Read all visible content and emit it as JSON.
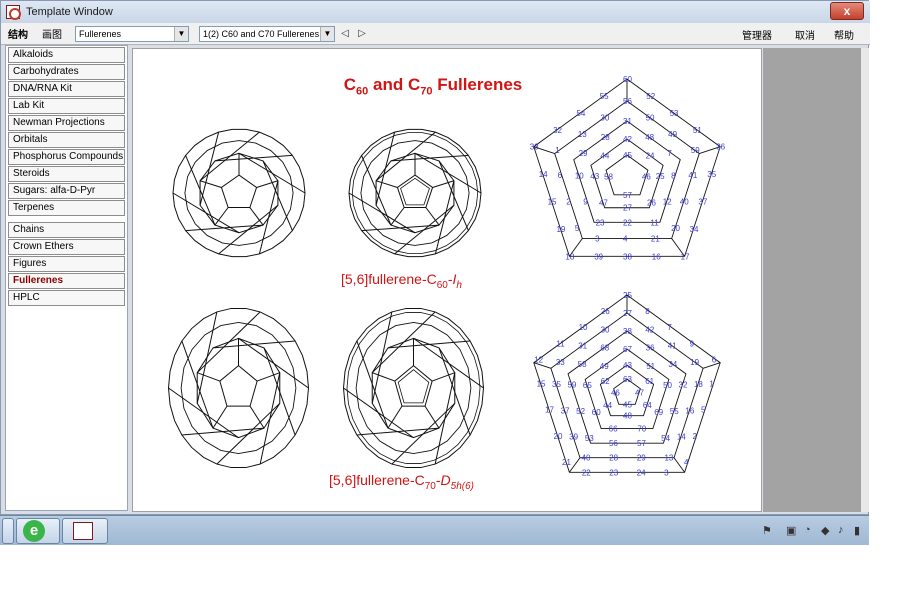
{
  "window": {
    "title": "Template Window",
    "close_glyph": "x"
  },
  "toolbar": {
    "tab_structure": "结构",
    "tab_draw": "画图",
    "category_select": "Fullerenes",
    "template_select": "1(2) C60 and C70 Fullerenes",
    "nav_back_icon": "back-arrow-icon",
    "nav_forward_icon": "forward-arrow-icon",
    "manager": "管理器",
    "cancel": "取消",
    "help": "帮助"
  },
  "sidebar": {
    "group1": [
      "Alkaloids",
      "Carbohydrates",
      "DNA/RNA Kit",
      "Lab Kit",
      "Newman Projections",
      "Orbitals",
      "Phosphorus Compounds",
      "Steroids",
      "Sugars: alfa-D-Pyr",
      "Terpenes"
    ],
    "group2": [
      "Chains",
      "Crown Ethers",
      "Figures",
      "Fullerenes",
      "HPLC"
    ],
    "selected": "Fullerenes"
  },
  "canvas": {
    "title_c": "C",
    "title_sub1": "60",
    "title_and": " and C",
    "title_sub2": "70",
    "title_end": " Fullerenes",
    "label1_a": "[5,6]fullerene-C",
    "label1_sub": "60",
    "label1_b": "-",
    "label1_i": "I",
    "label1_isub": "h",
    "label2_a": "[5,6]fullerene-C",
    "label2_sub": "70",
    "label2_b": "-",
    "label2_i": "D",
    "label2_isub": "5h(6)"
  },
  "schlegel_c60": {
    "numbers": [
      "60",
      "52",
      "53",
      "51",
      "36",
      "35",
      "37",
      "34",
      "17",
      "16",
      "38",
      "39",
      "18",
      "19",
      "15",
      "14",
      "33",
      "32",
      "54",
      "55",
      "56",
      "50",
      "49",
      "59",
      "41",
      "40",
      "20",
      "21",
      "4",
      "3",
      "5",
      "2",
      "6",
      "1",
      "13",
      "30",
      "31",
      "48",
      "7",
      "8",
      "12",
      "11",
      "22",
      "23",
      "9",
      "10",
      "29",
      "28",
      "42",
      "24",
      "25",
      "26",
      "27",
      "47",
      "43",
      "44",
      "45",
      "46",
      "57",
      "58"
    ]
  },
  "schlegel_c70": {
    "numbers": [
      "25",
      "8",
      "7",
      "9",
      "6",
      "1",
      "5",
      "2",
      "4",
      "3",
      "24",
      "23",
      "22",
      "21",
      "20",
      "17",
      "15",
      "12",
      "11",
      "10",
      "26",
      "27",
      "42",
      "41",
      "19",
      "18",
      "16",
      "14",
      "13",
      "29",
      "28",
      "40",
      "39",
      "37",
      "35",
      "33",
      "31",
      "30",
      "38",
      "36",
      "34",
      "32",
      "55",
      "54",
      "57",
      "56",
      "53",
      "52",
      "59",
      "58",
      "68",
      "67",
      "51",
      "50",
      "69",
      "70",
      "66",
      "60",
      "65",
      "49",
      "43",
      "61",
      "64",
      "48",
      "44",
      "62",
      "63",
      "47",
      "45",
      "46"
    ]
  },
  "taskbar": {
    "ie_label": "e",
    "tray_icons": [
      "flag-icon",
      "network-icon",
      "wifi-icon",
      "shield-icon",
      "speaker-icon",
      "battery-icon"
    ]
  }
}
